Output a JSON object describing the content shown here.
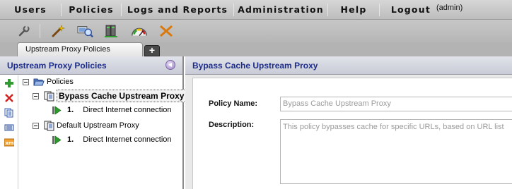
{
  "menu": {
    "items": [
      {
        "label": "Users"
      },
      {
        "label": "Policies"
      },
      {
        "label": "Logs and Reports"
      },
      {
        "label": "Administration"
      },
      {
        "label": "Help"
      },
      {
        "label": "Logout"
      }
    ],
    "user_badge": "(admin)"
  },
  "toolbar": {
    "icons": [
      "wrench-icon",
      "magic-wand-icon",
      "search-computer-icon",
      "servers-icon",
      "gauge-icon",
      "arrows-icon"
    ]
  },
  "tabs": {
    "active_label": "Upstream Proxy Policies",
    "add_label": "+"
  },
  "left_panel": {
    "title": "Upstream Proxy Policies",
    "side_tools": [
      "add-icon",
      "delete-icon",
      "copy-icon",
      "list-icon",
      "xml-icon"
    ],
    "tree": {
      "root": "Policies",
      "policies": [
        {
          "label": "Bypass Cache Upstream Proxy",
          "selected": true,
          "rules": [
            {
              "number": "1.",
              "label": "Direct Internet connection"
            }
          ]
        },
        {
          "label": "Default Upstream Proxy",
          "selected": false,
          "rules": [
            {
              "number": "1.",
              "label": "Direct Internet connection"
            }
          ]
        }
      ]
    }
  },
  "right_panel": {
    "title": "Bypass Cache Upstream Proxy",
    "form": {
      "policy_name_label": "Policy Name:",
      "policy_name_value": "Bypass Cache Upstream Proxy",
      "description_label": "Description:",
      "description_value": "This policy bypasses cache for specific URLs, based on URL list"
    }
  },
  "colors": {
    "header_text": "#1c2c8a",
    "menu_bg": "#c8c8c8",
    "add_green": "#2f9a2f",
    "delete_red": "#d22020",
    "rule_arrow_green": "#2d9a2d"
  }
}
